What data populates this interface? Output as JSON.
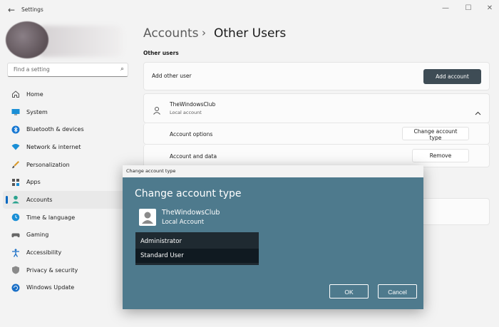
{
  "window": {
    "title": "Settings"
  },
  "search": {
    "placeholder": "Find a setting"
  },
  "nav": {
    "items": [
      {
        "label": "Home"
      },
      {
        "label": "System"
      },
      {
        "label": "Bluetooth & devices"
      },
      {
        "label": "Network & internet"
      },
      {
        "label": "Personalization"
      },
      {
        "label": "Apps"
      },
      {
        "label": "Accounts"
      },
      {
        "label": "Time & language"
      },
      {
        "label": "Gaming"
      },
      {
        "label": "Accessibility"
      },
      {
        "label": "Privacy & security"
      },
      {
        "label": "Windows Update"
      }
    ],
    "active": "Accounts"
  },
  "header": {
    "crumb_parent": "Accounts",
    "crumb_sep": "›",
    "crumb_current": "Other Users"
  },
  "other_users": {
    "section_title": "Other users",
    "add_label": "Add other user",
    "add_button": "Add account",
    "user": {
      "name": "TheWindowsClub",
      "type": "Local account",
      "account_options_label": "Account options",
      "change_type_button": "Change account type",
      "account_data_label": "Account and data",
      "remove_button": "Remove"
    }
  },
  "dialog": {
    "window_title": "Change account type",
    "heading": "Change account type",
    "user_name": "TheWindowsClub",
    "user_type": "Local Account",
    "options": [
      "Administrator",
      "Standard User"
    ],
    "selected": "Standard User",
    "ok_button": "OK",
    "cancel_button": "Cancel"
  },
  "colors": {
    "accent": "#0067c0",
    "dialog_bg": "#4e7a8d",
    "primary_button": "#3e4c55"
  }
}
